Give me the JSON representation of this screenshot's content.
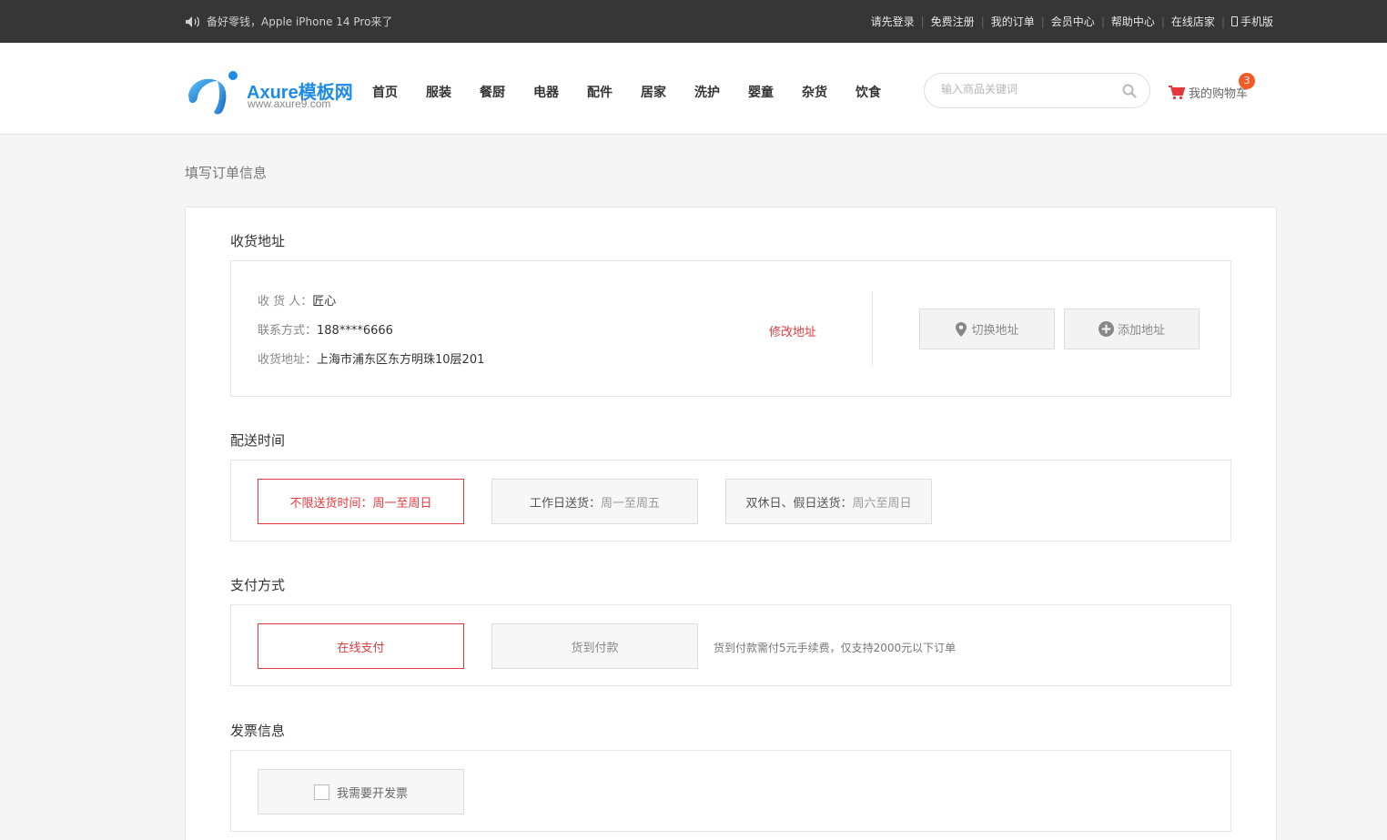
{
  "topbar": {
    "notice": "备好零钱，Apple iPhone 14 Pro来了",
    "links": [
      "请先登录",
      "免费注册",
      "我的订单",
      "会员中心",
      "帮助中心",
      "在线店家"
    ],
    "mobile": "手机版"
  },
  "header": {
    "logo_brand": "Axure模板网",
    "logo_url": "www.axure9.com",
    "nav": [
      "首页",
      "服装",
      "餐厨",
      "电器",
      "配件",
      "居家",
      "洗护",
      "婴童",
      "杂货",
      "饮食"
    ],
    "search_placeholder": "输入商品关键词",
    "cart_label": "我的购物车",
    "cart_count": "3"
  },
  "page": {
    "title": "填写订单信息"
  },
  "address": {
    "section_title": "收货地址",
    "receiver_label": "收 货 人：",
    "receiver": "匠心",
    "phone_label": "联系方式：",
    "phone": "188****6666",
    "address_label": "收货地址：",
    "address": "上海市浦东区东方明珠10层201",
    "edit_label": "修改地址",
    "switch_label": "切换地址",
    "add_label": "添加地址"
  },
  "delivery": {
    "section_title": "配送时间",
    "options": [
      {
        "main": "不限送货时间：",
        "sub": "周一至周日",
        "selected": true
      },
      {
        "main": "工作日送货：",
        "sub": "周一至周五",
        "selected": false
      },
      {
        "main": "双休日、假日送货：",
        "sub": "周六至周日",
        "selected": false
      }
    ]
  },
  "payment": {
    "section_title": "支付方式",
    "options": [
      {
        "label": "在线支付",
        "selected": true
      },
      {
        "label": "货到付款",
        "selected": false
      }
    ],
    "note": "货到付款需付5元手续费，仅支持2000元以下订单"
  },
  "invoice": {
    "section_title": "发票信息",
    "checkbox_label": "我需要开发票"
  },
  "colors": {
    "accent": "#e4393c",
    "brand": "#1e8be6",
    "badge": "#f25a28",
    "topbar": "#363636"
  }
}
